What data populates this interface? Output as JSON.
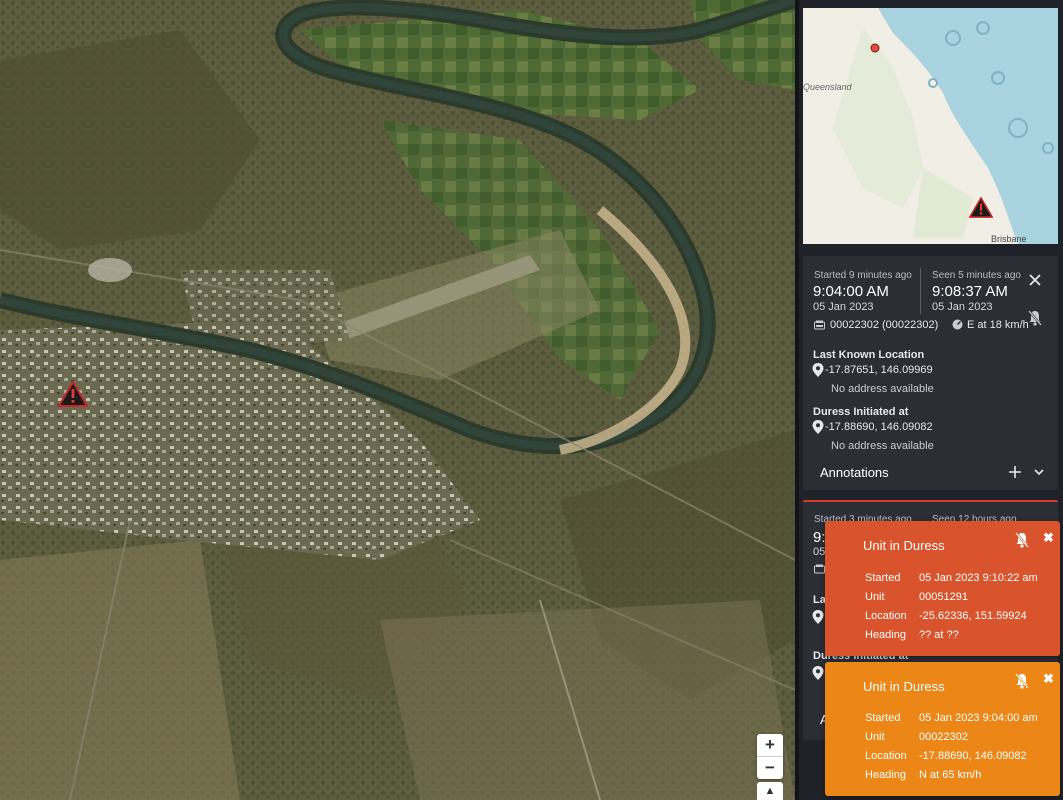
{
  "map": {
    "zoom_in": "+",
    "zoom_out": "−",
    "compass": "▲"
  },
  "minimap": {
    "region_label": "Queensland",
    "city_label": "Brisbane"
  },
  "card1": {
    "started_label": "Started 9 minutes ago",
    "started_time": "9:04:00 AM",
    "started_date": "05 Jan 2023",
    "seen_label": "Seen 5 minutes ago",
    "seen_time": "9:08:37 AM",
    "seen_date": "05 Jan 2023",
    "unit": "00022302 (00022302)",
    "heading": "E at 18 km/h",
    "last_known_title": "Last Known Location",
    "last_known_coords": "-17.87651, 146.09969",
    "last_known_address": "No address available",
    "duress_title": "Duress Initiated at",
    "duress_coords": "-17.88690, 146.09082",
    "duress_address": "No address available",
    "annotations_label": "Annotations"
  },
  "card2": {
    "started_label": "Started 3 minutes ago",
    "seen_label": "Seen 12 hours ago",
    "started_time_partial": "9:",
    "date_partial": "05",
    "last_known_partial": "La",
    "duress_title": "Duress Initiated at",
    "annotations_partial": "A"
  },
  "toasts": [
    {
      "title": "Unit in Duress",
      "color": "#d9542c",
      "started_label": "Started",
      "started": "05 Jan 2023 9:10:22 am",
      "unit_label": "Unit",
      "unit": "00051291",
      "location_label": "Location",
      "location": "-25.62336, 151.59924",
      "heading_label": "Heading",
      "heading": "?? at ??",
      "close": "✖"
    },
    {
      "title": "Unit in Duress",
      "color": "#ec8616",
      "started_label": "Started",
      "started": "05 Jan 2023 9:04:00 am",
      "unit_label": "Unit",
      "unit": "00022302",
      "location_label": "Location",
      "location": "-17.88690, 146.09082",
      "heading_label": "Heading",
      "heading": "N at 65 km/h",
      "close": "✖"
    }
  ],
  "icons": {
    "close": "close-icon",
    "mute": "bell-off-icon",
    "vehicle": "vehicle-icon",
    "speed": "speedometer-icon",
    "pin": "location-pin-icon",
    "add": "plus-icon",
    "expand": "chevron-down-icon",
    "warning": "warning-triangle-icon"
  },
  "colors": {
    "panel_bg": "#1f2228",
    "card_bg": "#2b2e35",
    "alert_red": "#d9542c",
    "alert_orange": "#ec8616",
    "card2_border": "#d23a2a"
  }
}
